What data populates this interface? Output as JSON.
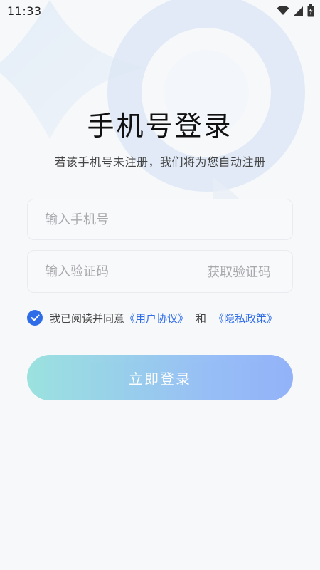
{
  "status_bar": {
    "time": "11:33"
  },
  "login": {
    "title": "手机号登录",
    "subtitle": "若该手机号未注册，我们将为您自动注册",
    "phone_placeholder": "输入手机号",
    "code_placeholder": "输入验证码",
    "get_code_label": "获取验证码",
    "agreement": {
      "checked": true,
      "prefix": "我已阅读并同意",
      "user_agreement": "《用户协议》",
      "conjunction": "和",
      "privacy_policy": "《隐私政策》"
    },
    "submit_label": "立即登录"
  },
  "colors": {
    "accent": "#2f6de8",
    "button_gradient_start": "#93e0dc",
    "button_gradient_end": "#8aacf8",
    "background": "#f7f8fa"
  },
  "icons": [
    "wifi-icon",
    "cellular-signal-icon",
    "battery-charging-icon",
    "checkmark-icon"
  ]
}
